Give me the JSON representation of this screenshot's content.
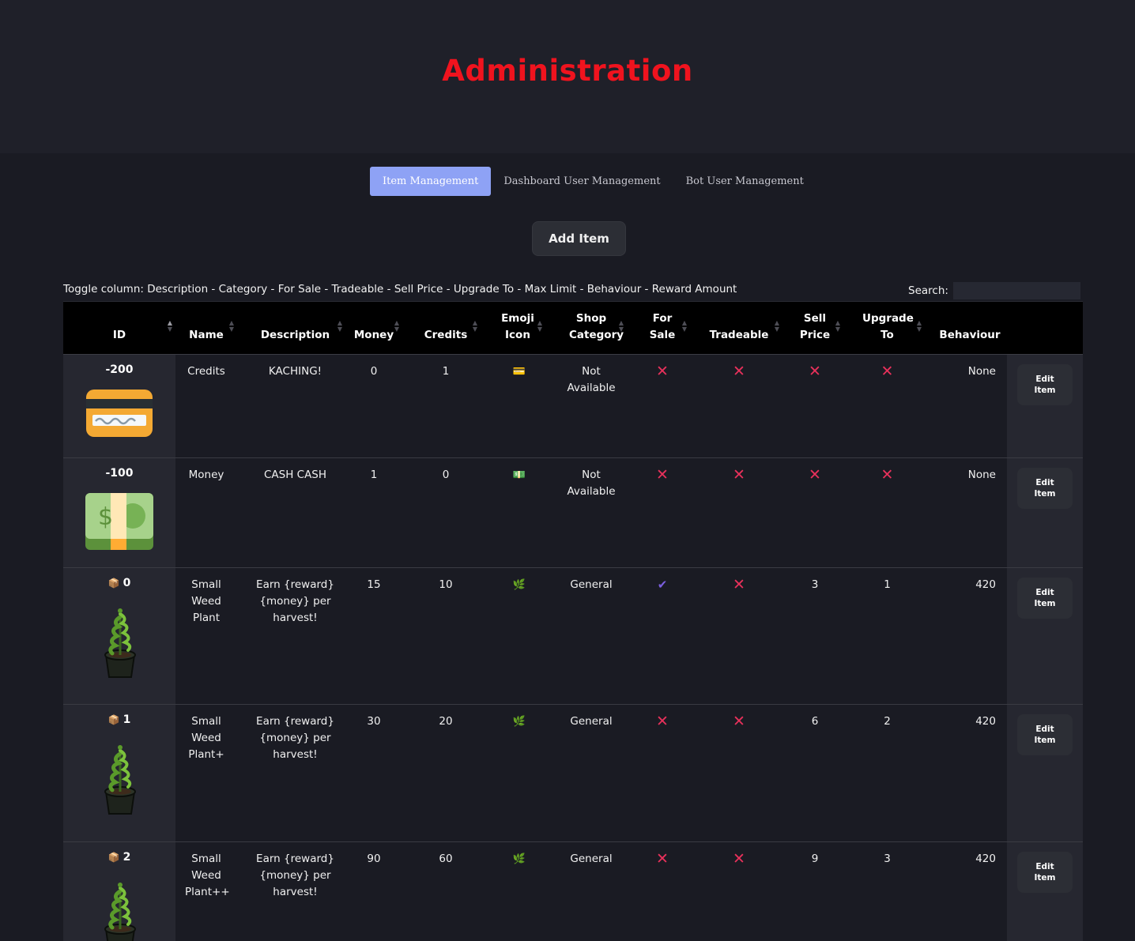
{
  "page": {
    "title": "Administration"
  },
  "tabs": [
    {
      "label": "Item Management",
      "active": true
    },
    {
      "label": "Dashboard User Management",
      "active": false
    },
    {
      "label": "Bot User Management",
      "active": false
    }
  ],
  "add_item_label": "Add Item",
  "toggle": {
    "prefix": "Toggle column: ",
    "separator": " - ",
    "columns": [
      "Description",
      "Category",
      "For Sale",
      "Tradeable",
      "Sell Price",
      "Upgrade To",
      "Max Limit",
      "Behaviour",
      "Reward Amount"
    ]
  },
  "search": {
    "label": "Search:",
    "value": ""
  },
  "columns": [
    "ID",
    "Name",
    "Description",
    "Money",
    "Credits",
    "Emoji Icon",
    "Shop Category",
    "For Sale",
    "Tradeable",
    "Sell Price",
    "Upgrade To",
    "Behaviour"
  ],
  "edit_label": "Edit Item",
  "rows": [
    {
      "id": "-200",
      "box": "",
      "image": "credit-card",
      "name": "Credits",
      "description": "KACHING!",
      "money": "0",
      "credits": "1",
      "emoji": "💳",
      "category": "Not Available",
      "for_sale": "no",
      "tradeable": "no",
      "sell_price": "no",
      "upgrade_to": "no",
      "behaviour": "None"
    },
    {
      "id": "-100",
      "box": "",
      "image": "dollar-bill",
      "name": "Money",
      "description": "CASH CASH",
      "money": "1",
      "credits": "0",
      "emoji": "💵",
      "category": "Not Available",
      "for_sale": "no",
      "tradeable": "no",
      "sell_price": "no",
      "upgrade_to": "no",
      "behaviour": "None"
    },
    {
      "id": "0",
      "box": "📦",
      "image": "weed-plant",
      "name": "Small Weed Plant",
      "description": "Earn {reward} {money} per harvest!",
      "money": "15",
      "credits": "10",
      "emoji": "🌿",
      "category": "General",
      "for_sale": "yes",
      "tradeable": "no",
      "sell_price": "3",
      "upgrade_to": "1",
      "behaviour": "420"
    },
    {
      "id": "1",
      "box": "📦",
      "image": "weed-plant",
      "name": "Small Weed Plant+",
      "description": "Earn {reward} {money} per harvest!",
      "money": "30",
      "credits": "20",
      "emoji": "🌿",
      "category": "General",
      "for_sale": "no",
      "tradeable": "no",
      "sell_price": "6",
      "upgrade_to": "2",
      "behaviour": "420"
    },
    {
      "id": "2",
      "box": "📦",
      "image": "weed-plant",
      "name": "Small Weed Plant++",
      "description": "Earn {reward} {money} per harvest!",
      "money": "90",
      "credits": "60",
      "emoji": "🌿",
      "category": "General",
      "for_sale": "no",
      "tradeable": "no",
      "sell_price": "9",
      "upgrade_to": "3",
      "behaviour": "420"
    }
  ]
}
